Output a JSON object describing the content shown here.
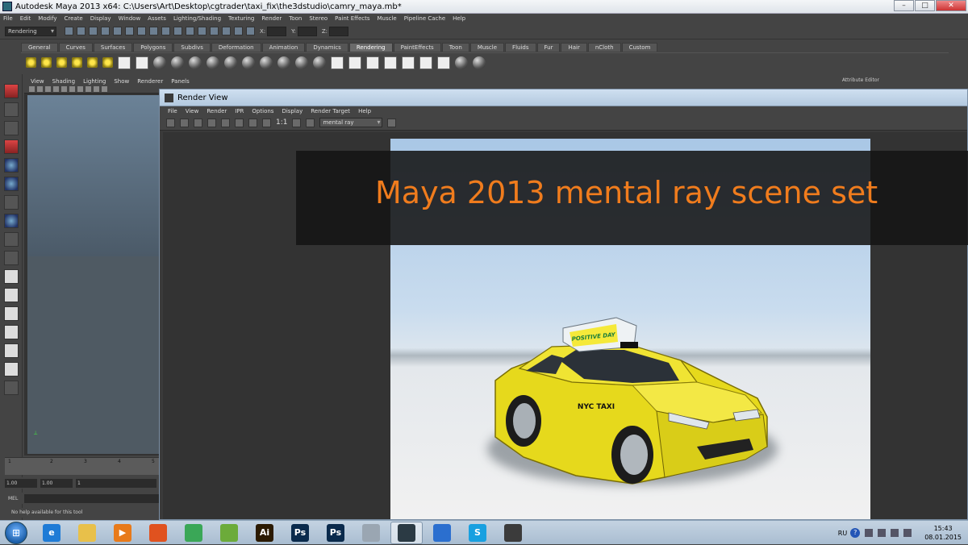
{
  "window": {
    "title": "Autodesk Maya 2013 x64: C:\\Users\\Art\\Desktop\\cgtrader\\taxi_fix\\the3dstudio\\camry_maya.mb*"
  },
  "menubar": [
    "File",
    "Edit",
    "Modify",
    "Create",
    "Display",
    "Window",
    "Assets",
    "Lighting/Shading",
    "Texturing",
    "Render",
    "Toon",
    "Stereo",
    "Paint Effects",
    "Muscle",
    "Pipeline Cache",
    "Help"
  ],
  "status_line": {
    "mode": "Rendering",
    "coord_labels": [
      "X:",
      "Y:",
      "Z:"
    ]
  },
  "shelf": {
    "tabs": [
      "General",
      "Curves",
      "Surfaces",
      "Polygons",
      "Subdivs",
      "Deformation",
      "Animation",
      "Dynamics",
      "Rendering",
      "PaintEffects",
      "Toon",
      "Muscle",
      "Fluids",
      "Fur",
      "Hair",
      "nCloth",
      "Custom"
    ],
    "active_tab": "Rendering"
  },
  "viewport": {
    "menu": [
      "View",
      "Shading",
      "Lighting",
      "Show",
      "Renderer",
      "Panels"
    ]
  },
  "attribute_editor_label": "Attribute Editor",
  "timeline": {
    "ticks": [
      "1",
      "2",
      "3",
      "4",
      "5"
    ],
    "range_start": "1.00",
    "range_current": "1.00",
    "range_frame": "1"
  },
  "command_line": {
    "label": "MEL"
  },
  "help_line": "No help available for this tool",
  "render_view": {
    "title": "Render View",
    "menu": [
      "File",
      "View",
      "Render",
      "IPR",
      "Options",
      "Display",
      "Render Target",
      "Help"
    ],
    "ratio": "1:1",
    "renderer": "mental ray",
    "sign_text": "POSITIVE DAY",
    "door_text": "NYC TAXI"
  },
  "overlay": {
    "banner_text": "Maya 2013 mental ray scene set",
    "banner_color": "#f07c1d"
  },
  "taskbar": {
    "apps": [
      {
        "name": "internet-explorer-icon",
        "color": "#1e7bd6",
        "glyph": "e"
      },
      {
        "name": "file-explorer-icon",
        "color": "#e8c04a",
        "glyph": ""
      },
      {
        "name": "media-player-icon",
        "color": "#e87a1a",
        "glyph": "▶"
      },
      {
        "name": "firefox-icon",
        "color": "#e0521f",
        "glyph": ""
      },
      {
        "name": "chrome-icon",
        "color": "#3aa757",
        "glyph": ""
      },
      {
        "name": "maps-icon",
        "color": "#6cab3a",
        "glyph": ""
      },
      {
        "name": "illustrator-icon",
        "color": "#2b1a02",
        "glyph": "Ai"
      },
      {
        "name": "photoshop-icon",
        "color": "#0a2a4c",
        "glyph": "Ps"
      },
      {
        "name": "photoshop-2-icon",
        "color": "#0a2a4c",
        "glyph": "Ps"
      },
      {
        "name": "calculator-icon",
        "color": "#9aa6b2",
        "glyph": ""
      },
      {
        "name": "maya-icon",
        "color": "#2b3a44",
        "glyph": ""
      },
      {
        "name": "notepad-icon",
        "color": "#2b6fcf",
        "glyph": ""
      },
      {
        "name": "skype-icon",
        "color": "#18a0e0",
        "glyph": "S"
      },
      {
        "name": "tablet-icon",
        "color": "#3b3b3b",
        "glyph": ""
      }
    ],
    "tray": {
      "language": "RU",
      "time": "15:43",
      "date": "08.01.2015"
    }
  }
}
